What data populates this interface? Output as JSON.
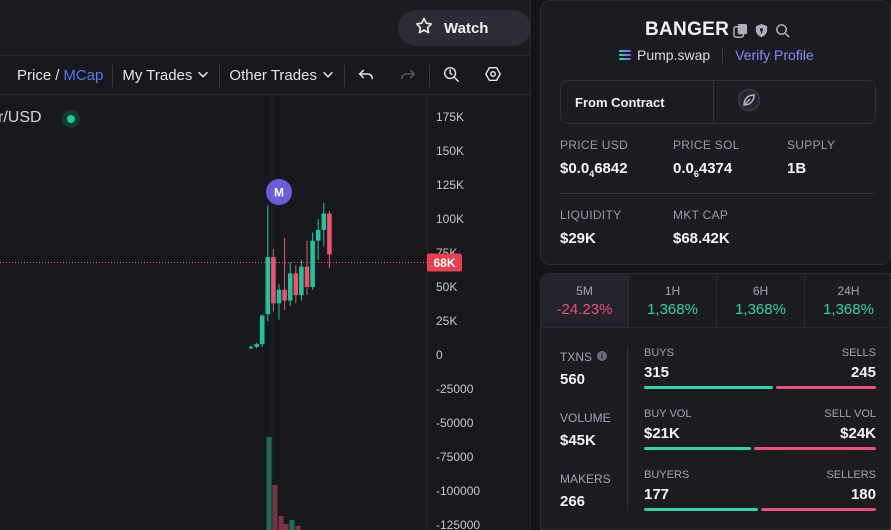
{
  "chart": {
    "watch_label": "Watch",
    "price_label": "Price",
    "price_sep": "/",
    "mcap_label": "MCap",
    "my_trades_label": "My Trades",
    "other_trades_label": "Other Trades",
    "pair_label": "r/USD",
    "marker_letter": "M",
    "current_value_tag": "68K",
    "y_ticks": [
      "175K",
      "150K",
      "125K",
      "100K",
      "75K",
      "50K",
      "25K",
      "0",
      "-25000",
      "-50000",
      "-75000",
      "-100000",
      "-125000"
    ],
    "colors": {
      "up": "#22c39a",
      "down": "#f0526b",
      "marker": "#6a5ce0"
    }
  },
  "chart_data": {
    "type": "candlestick",
    "y_unit": "market cap (USD)",
    "ylim": [
      -125000,
      175000
    ],
    "current_value": 68000,
    "candles": [
      {
        "o": 5000,
        "h": 7000,
        "l": 4000,
        "c": 6000
      },
      {
        "o": 6000,
        "h": 9000,
        "l": 5000,
        "c": 8000
      },
      {
        "o": 8000,
        "h": 30000,
        "l": 6000,
        "c": 29000
      },
      {
        "o": 30000,
        "h": 110000,
        "l": 25000,
        "c": 72000
      },
      {
        "o": 72000,
        "h": 78000,
        "l": 32000,
        "c": 38000
      },
      {
        "o": 38000,
        "h": 52000,
        "l": 26000,
        "c": 48000
      },
      {
        "o": 48000,
        "h": 86000,
        "l": 33000,
        "c": 40000
      },
      {
        "o": 40000,
        "h": 68000,
        "l": 36000,
        "c": 60000
      },
      {
        "o": 60000,
        "h": 66000,
        "l": 38000,
        "c": 44000
      },
      {
        "o": 44000,
        "h": 70000,
        "l": 40000,
        "c": 65000
      },
      {
        "o": 65000,
        "h": 84000,
        "l": 44000,
        "c": 50000
      },
      {
        "o": 50000,
        "h": 90000,
        "l": 48000,
        "c": 84000
      },
      {
        "o": 84000,
        "h": 100000,
        "l": 70000,
        "c": 92000
      },
      {
        "o": 92000,
        "h": 112000,
        "l": 80000,
        "c": 104000
      },
      {
        "o": 104000,
        "h": 106000,
        "l": 64000,
        "c": 74000
      }
    ]
  },
  "token": {
    "name": "BANGER",
    "dex": "Pump.swap",
    "verify_label": "Verify Profile",
    "contract_label": "From Contract",
    "stats": [
      {
        "key": "PRICE USD",
        "value_pre": "$0.0",
        "value_sub": "4",
        "value_post": "6842"
      },
      {
        "key": "PRICE SOL",
        "value_pre": "0.0",
        "value_sub": "6",
        "value_post": "4374"
      },
      {
        "key": "SUPPLY",
        "value_pre": "1B",
        "value_sub": "",
        "value_post": ""
      },
      {
        "key": "LIQUIDITY",
        "value_pre": "$29K",
        "value_sub": "",
        "value_post": ""
      },
      {
        "key": "MKT CAP",
        "value_pre": "$68.42K",
        "value_sub": "",
        "value_post": ""
      }
    ]
  },
  "timeframes": [
    {
      "label": "5M",
      "change": "-24.23%",
      "trend": "neg"
    },
    {
      "label": "1H",
      "change": "1,368%",
      "trend": "pos"
    },
    {
      "label": "6H",
      "change": "1,368%",
      "trend": "pos"
    },
    {
      "label": "24H",
      "change": "1,368%",
      "trend": "pos"
    }
  ],
  "txns": {
    "txns_label": "TXNS",
    "txns_value": "560",
    "volume_label": "VOLUME",
    "volume_value": "$45K",
    "makers_label": "MAKERS",
    "makers_value": "266",
    "buys_label": "BUYS",
    "buys_value": "315",
    "sells_label": "SELLS",
    "sells_value": "245",
    "buy_vol_label": "BUY VOL",
    "buy_vol_value": "$21K",
    "sell_vol_label": "SELL VOL",
    "sell_vol_value": "$24K",
    "buyers_label": "BUYERS",
    "buyers_value": "177",
    "sellers_label": "SELLERS",
    "sellers_value": "180"
  },
  "bar_ratios": {
    "buys": 0.5625,
    "buy_vol": 0.4667,
    "buyers": 0.4958
  }
}
